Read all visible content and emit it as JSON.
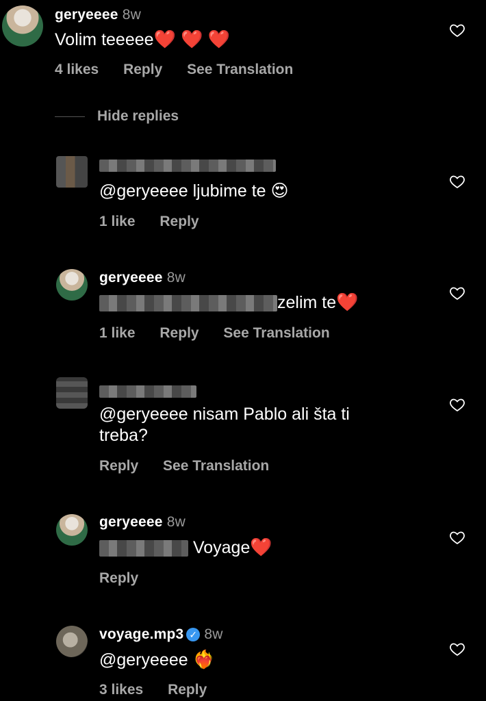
{
  "main_comment": {
    "username": "geryeeee",
    "time": "8w",
    "text": "Volim teeeee",
    "emoji": "❤️ ❤️ ❤️",
    "likes": "4 likes",
    "reply": "Reply",
    "translate": "See Translation"
  },
  "hide_replies": "Hide replies",
  "replies": [
    {
      "username": "",
      "time": "",
      "mention": "@geryeeee",
      "text": "ljubime te",
      "emoji": "😍",
      "likes": "1 like",
      "reply": "Reply"
    },
    {
      "username": "geryeeee",
      "time": "8w",
      "text": "zelim te",
      "emoji": "❤️",
      "likes": "1 like",
      "reply": "Reply",
      "translate": "See Translation"
    },
    {
      "mention": "@geryeeee",
      "text_line1": "nisam Pablo ali šta ti",
      "text_line2": "treba?",
      "reply": "Reply",
      "translate": "See Translation"
    },
    {
      "username": "geryeeee",
      "time": "8w",
      "text": "Voyage",
      "emoji": "❤️",
      "reply": "Reply"
    },
    {
      "username": "voyage.mp3",
      "time": "8w",
      "mention": "@geryeeee",
      "emoji": "❤️‍🔥",
      "likes": "3 likes",
      "reply": "Reply"
    }
  ],
  "icons": {
    "like": "heart-outline-icon",
    "verified": "verified-badge-icon"
  }
}
